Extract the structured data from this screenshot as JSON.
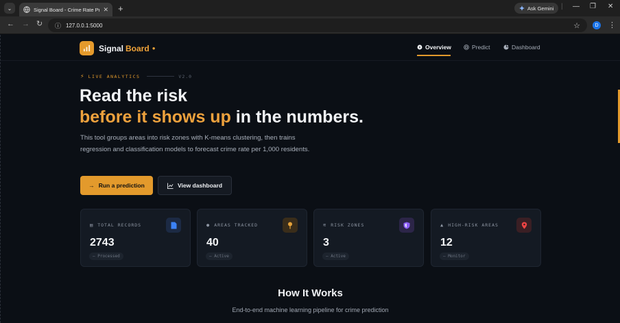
{
  "browser": {
    "tab_title": "Signal Board - Crime Rate Predi",
    "ask_gemini": "Ask Gemini",
    "url": "127.0.0.1:5000",
    "profile_initial": "D"
  },
  "header": {
    "logo_word1": "Signal",
    "logo_word2": "Board",
    "nav": [
      "Overview",
      "Predict",
      "Dashboard"
    ],
    "active_nav": "Overview"
  },
  "hero": {
    "badge": "LIVE ANALYTICS",
    "version": "V2.0",
    "title_line1": "Read the risk",
    "title_accent": "before it shows up",
    "title_rest": " in the numbers.",
    "description": "This tool groups areas into risk zones with K-means clustering, then trains regression and classification models to forecast crime rate per 1,000 residents.",
    "primary_button": "Run a prediction",
    "secondary_button": "View dashboard"
  },
  "stats": [
    {
      "label": "TOTAL RECORDS",
      "value": "2743",
      "chip": "— Processed",
      "icon": "document-icon",
      "color": "#3b82f6"
    },
    {
      "label": "AREAS TRACKED",
      "value": "40",
      "chip": "— Active",
      "icon": "pin-icon",
      "color": "#e5a23a"
    },
    {
      "label": "RISK ZONES",
      "value": "3",
      "chip": "— Active",
      "icon": "shield-icon",
      "color": "#8b5cf6"
    },
    {
      "label": "HIGH-RISK AREAS",
      "value": "12",
      "chip": "— Monitor",
      "icon": "location-icon",
      "color": "#ef4444"
    }
  ],
  "how_it_works": {
    "title": "How It Works",
    "subtitle": "End-to-end machine learning pipeline for crime prediction"
  },
  "colors": {
    "accent": "#e39a2c",
    "background": "#0b0f15",
    "card": "#141a23"
  }
}
